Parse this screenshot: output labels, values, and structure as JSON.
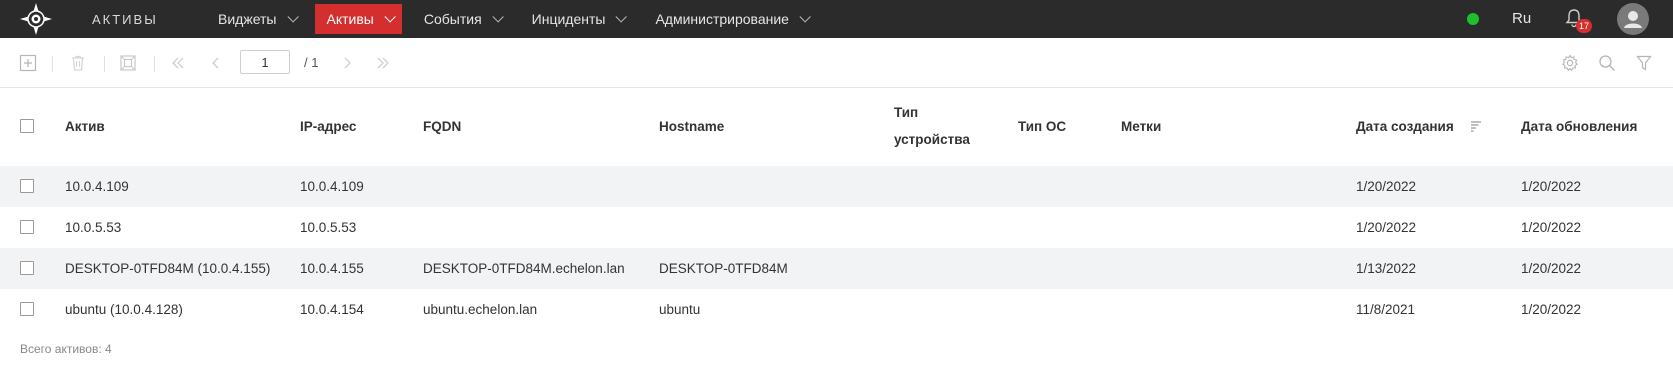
{
  "app": {
    "title": "АКТИВЫ"
  },
  "nav": [
    {
      "label": "Виджеты",
      "active": false
    },
    {
      "label": "Активы",
      "active": true
    },
    {
      "label": "События",
      "active": false
    },
    {
      "label": "Инциденты",
      "active": false
    },
    {
      "label": "Администрирование",
      "active": false
    }
  ],
  "top_right": {
    "language": "Ru",
    "notifications_count": "17",
    "status_color": "#1ec12b"
  },
  "toolbar": {
    "page_value": "1",
    "page_total": "/ 1"
  },
  "table": {
    "columns": {
      "asset": "Актив",
      "ip": "IP-адрес",
      "fqdn": "FQDN",
      "hostname": "Hostname",
      "device_type_line1": "Тип",
      "device_type_line2": "устройства",
      "os_type": "Тип ОС",
      "tags": "Метки",
      "created": "Дата создания",
      "updated": "Дата обновления"
    },
    "rows": [
      {
        "asset": "10.0.4.109",
        "ip": "10.0.4.109",
        "fqdn": "",
        "hostname": "",
        "device_type": "",
        "os_type": "",
        "tags": "",
        "created": "1/20/2022",
        "updated": "1/20/2022"
      },
      {
        "asset": "10.0.5.53",
        "ip": "10.0.5.53",
        "fqdn": "",
        "hostname": "",
        "device_type": "",
        "os_type": "",
        "tags": "",
        "created": "1/20/2022",
        "updated": "1/20/2022"
      },
      {
        "asset": "DESKTOP-0TFD84M (10.0.4.155)",
        "ip": "10.0.4.155",
        "fqdn": "DESKTOP-0TFD84M.echelon.lan",
        "hostname": "DESKTOP-0TFD84M",
        "device_type": "",
        "os_type": "",
        "tags": "",
        "created": "1/13/2022",
        "updated": "1/20/2022"
      },
      {
        "asset": "ubuntu (10.0.4.128)",
        "ip": "10.0.4.154",
        "fqdn": "ubuntu.echelon.lan",
        "hostname": "ubuntu",
        "device_type": "",
        "os_type": "",
        "tags": "",
        "created": "11/8/2021",
        "updated": "1/20/2022"
      }
    ]
  },
  "footer": {
    "total_text": "Всего активов: 4"
  },
  "colors": {
    "topbar": "#2b2b2b",
    "accent": "#d42e2e",
    "row_alt": "#f2f3f5"
  }
}
